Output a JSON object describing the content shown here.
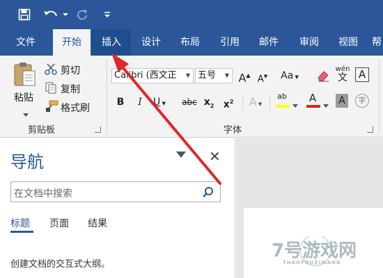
{
  "quick_access": {
    "save_icon": "save-icon",
    "undo_icon": "undo-icon",
    "redo_icon": "redo-icon",
    "customize_icon": "customize-qat-icon"
  },
  "tabs": [
    {
      "label": "文件"
    },
    {
      "label": "开始",
      "state": "selected"
    },
    {
      "label": "插入",
      "state": "hover"
    },
    {
      "label": "设计"
    },
    {
      "label": "布局"
    },
    {
      "label": "引用"
    },
    {
      "label": "邮件"
    },
    {
      "label": "审阅"
    },
    {
      "label": "视图"
    },
    {
      "label": "帮"
    }
  ],
  "ribbon": {
    "clipboard": {
      "group_label": "剪贴板",
      "paste_label": "粘贴",
      "cut_label": "剪切",
      "copy_label": "复制",
      "format_painter_label": "格式刷"
    },
    "font": {
      "group_label": "字体",
      "font_name": "Calibri (西文正",
      "font_size": "五号",
      "grow_font": "A",
      "shrink_font": "A",
      "change_case": "Aa",
      "phonetic_guide": "wén",
      "bold": "B",
      "italic": "I",
      "underline": "U",
      "strikethrough": "abc",
      "subscript": "x",
      "superscript": "x",
      "text_effects": "A",
      "highlight": "ab",
      "font_color": "A",
      "char_shading": "A",
      "enclose_char": "字",
      "char_border": "A"
    }
  },
  "navigation": {
    "title": "导航",
    "close": "✕",
    "search_placeholder": "在文档中搜索",
    "tabs": [
      {
        "label": "标题",
        "state": "selected"
      },
      {
        "label": "页面"
      },
      {
        "label": "结果"
      }
    ],
    "description": "创建文档的交互式大纲。"
  },
  "watermark": {
    "brand": "7号游戏网",
    "sub": "THAOYOUXIWANG"
  },
  "colors": {
    "accent": "#2b579a",
    "highlight_yellow": "#ffff00",
    "font_red": "#e0201b",
    "arrow_red": "#e0262b"
  }
}
